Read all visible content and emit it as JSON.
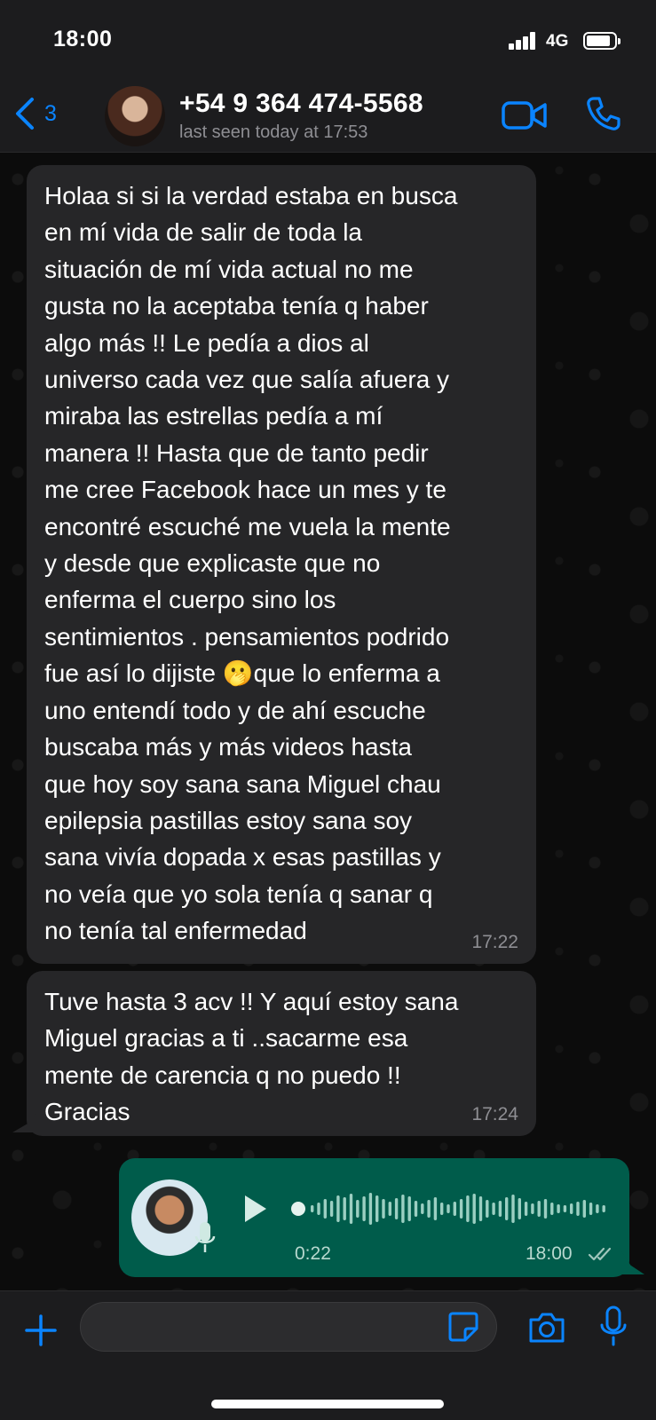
{
  "status_bar": {
    "time": "18:00",
    "network": "4G",
    "icons": [
      "signal-icon",
      "battery-icon"
    ]
  },
  "header": {
    "back_count": "3",
    "contact_name": "+54 9 364 474-5568",
    "contact_status": "last seen today at 17:53",
    "icons": [
      "back-chevron-icon",
      "video-call-icon",
      "phone-call-icon"
    ],
    "accent_color": "#0a84ff"
  },
  "messages": [
    {
      "text": "Holaa si si la verdad estaba en busca\nen mí vida de salir de toda la\nsituación de mí vida actual no me\ngusta no la aceptaba tenía q haber\nalgo más !! Le pedía a dios al\nuniverso cada vez que salía afuera y\nmiraba las estrellas pedía a mí\nmanera !! Hasta que de tanto pedir\nme cree Facebook hace un mes y te\nencontré escuché me vuela la mente\ny desde que explicaste que no\nenferma el cuerpo sino los\nsentimientos . pensamientos podrido\nfue así lo dijiste 🫢que lo enferma a\nuno entendí todo y de ahí escuche\nbuscaba más y más videos hasta\nque hoy soy sana sana Miguel chau\nepilepsia pastillas estoy sana soy\nsana vivía dopada x esas pastillas y\nno veía que yo sola tenía q sanar q\nno tenía tal enfermedad",
      "time": "17:22"
    },
    {
      "text": "Tuve hasta 3 acv !! Y aquí estoy sana\nMiguel gracias a ti ..sacarme esa\nmente de carencia q no puedo !!\nGracias",
      "time": "17:24"
    }
  ],
  "voice_note": {
    "duration": "0:22",
    "time": "18:00",
    "status": "read",
    "bubble_color": "#005c4b",
    "icons": [
      "play-icon",
      "microphone-icon",
      "double-check-icon"
    ]
  },
  "input_bar": {
    "icons": [
      "plus-icon",
      "sticker-icon",
      "camera-icon",
      "microphone-icon"
    ]
  },
  "colors": {
    "incoming_bubble": "#262628",
    "background": "#0b0b0b",
    "bar": "#1c1c1e"
  }
}
